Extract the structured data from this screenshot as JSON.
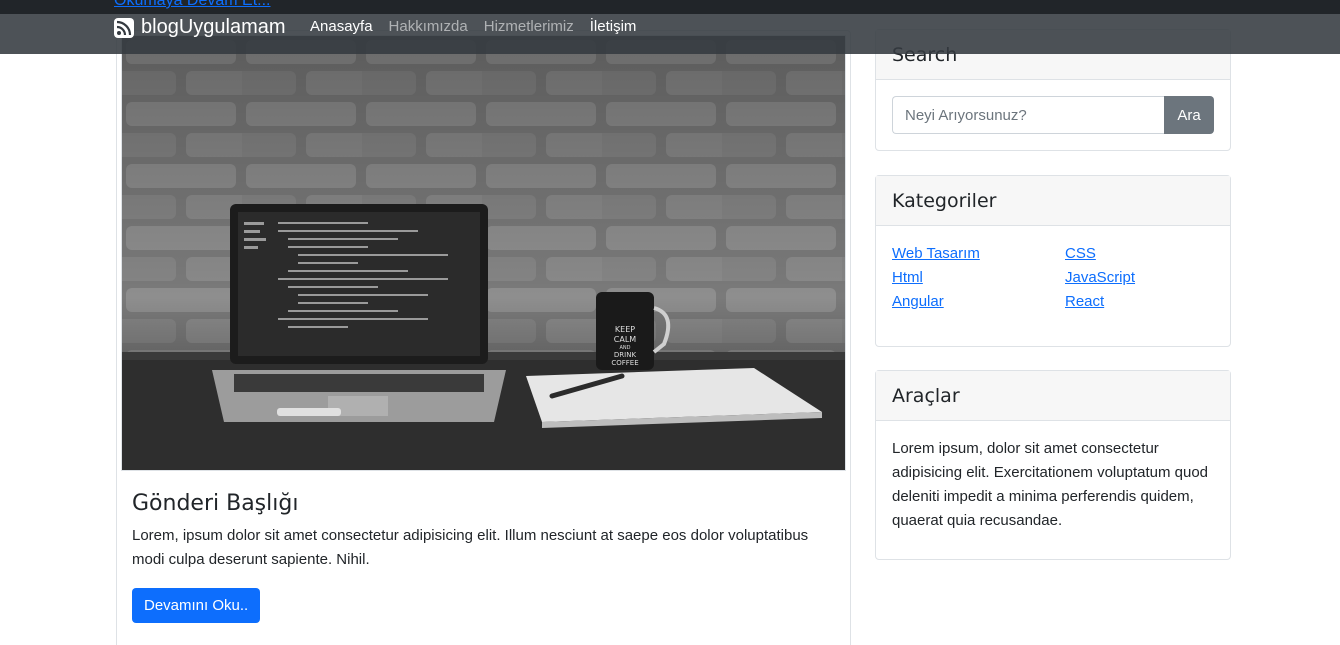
{
  "navbar": {
    "brand": "blogUygulamam",
    "links": [
      "Anasayfa",
      "Hakkımızda",
      "Hizmetlerimiz",
      "İletişim"
    ]
  },
  "peek_link": "Okumaya Devam Et...",
  "post": {
    "title": "Gönderi Başlığı",
    "text": "Lorem, ipsum dolor sit amet consectetur adipisicing elit. Illum nesciunt at saepe eos dolor voluptatibus modi culpa deserunt sapiente. Nihil.",
    "button": "Devamını Oku..",
    "mug_text": [
      "KEEP",
      "CALM",
      "AND",
      "DRINK",
      "COFFEE"
    ]
  },
  "search": {
    "title": "Search",
    "placeholder": "Neyi Arıyorsunuz?",
    "button": "Ara"
  },
  "categories": {
    "title": "Kategoriler",
    "items": [
      "Web Tasarım",
      "CSS",
      "Html",
      "JavaScript",
      "Angular",
      "React"
    ]
  },
  "tools": {
    "title": "Araçlar",
    "text": "Lorem ipsum, dolor sit amet consectetur adipisicing elit. Exercitationem voluptatum quod deleniti impedit a minima perferendis quidem, quaerat quia recusandae."
  },
  "colors": {
    "primary": "#0d6efd",
    "navbar": "#343a40",
    "secondary": "#6c757d"
  }
}
